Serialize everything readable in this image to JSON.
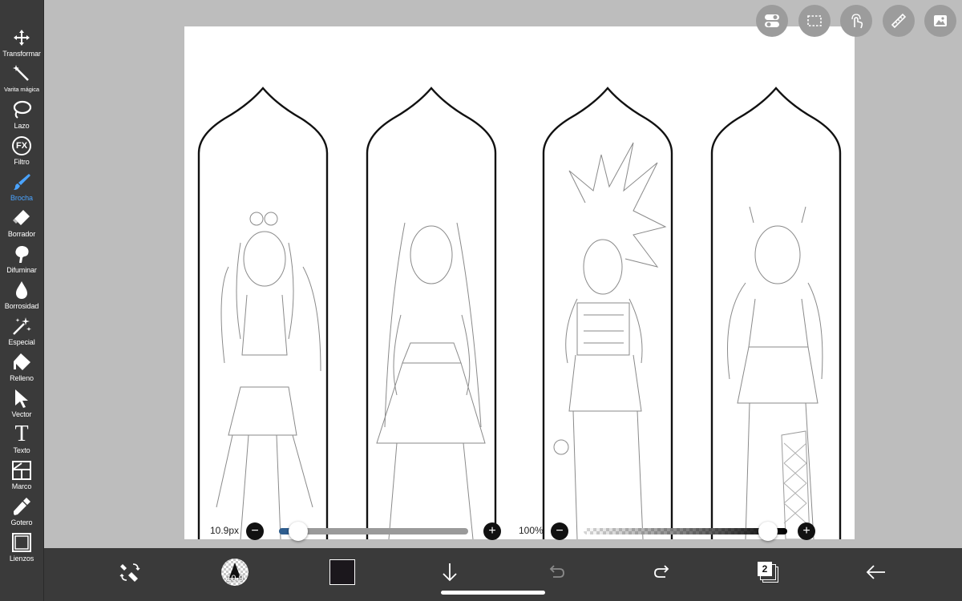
{
  "sidebar": {
    "tools": [
      {
        "label": "Transformar",
        "icon": "move-icon"
      },
      {
        "label": "Varita mágica",
        "icon": "magic-wand-icon"
      },
      {
        "label": "Lazo",
        "icon": "lasso-icon"
      },
      {
        "label": "Filtro",
        "icon": "fx-icon",
        "glyph": "FX"
      },
      {
        "label": "Brocha",
        "icon": "brush-icon",
        "active": true
      },
      {
        "label": "Borrador",
        "icon": "eraser-icon"
      },
      {
        "label": "Difuminar",
        "icon": "smudge-icon"
      },
      {
        "label": "Borrosidad",
        "icon": "blur-drop-icon"
      },
      {
        "label": "Especial",
        "icon": "special-sparkle-icon"
      },
      {
        "label": "Relleno",
        "icon": "fill-bucket-icon"
      },
      {
        "label": "Vector",
        "icon": "vector-arrow-icon"
      },
      {
        "label": "Texto",
        "icon": "text-icon",
        "glyph": "T"
      },
      {
        "label": "Marco",
        "icon": "frame-icon"
      },
      {
        "label": "Gotero",
        "icon": "eyedropper-icon"
      },
      {
        "label": "Lienzos",
        "icon": "canvas-icon"
      }
    ]
  },
  "top_buttons": [
    "toggle-settings-icon",
    "selection-rect-icon",
    "touch-gesture-icon",
    "ruler-icon",
    "image-gallery-icon"
  ],
  "brush_size": {
    "label": "10.9px",
    "value": 10.9,
    "level": 0.1
  },
  "opacity": {
    "label": "100%",
    "value": 100,
    "level": 1.0
  },
  "bottom_bar": {
    "brush_preview_size": "10.9",
    "current_color": "#1b171c",
    "layer_count": "2"
  },
  "colors": {
    "accent": "#4aa3ff",
    "slider_fill": "#2e5d8e"
  }
}
